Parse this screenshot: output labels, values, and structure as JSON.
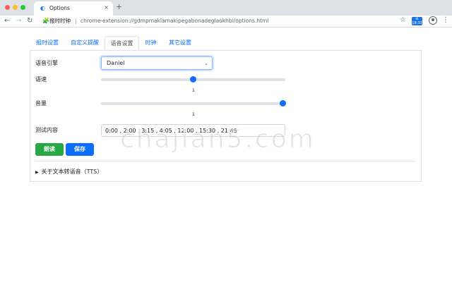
{
  "browser": {
    "tab_title": "Options",
    "tab_icon": "◐",
    "close_glyph": "×",
    "newtab_glyph": "+",
    "back_glyph": "←",
    "forward_glyph": "→",
    "reload_glyph": "↻",
    "site_icon": "🧩",
    "site_name": "报时时钟",
    "separator": "|",
    "url": "chrome-extension://gdmpmaklamakipegabonadeglaokhbl/options.html",
    "star_glyph": "☆",
    "extension_badge_top": "ılı",
    "extension_badge_time": "18:33",
    "menu_glyph": "⋮"
  },
  "tabs": [
    {
      "label": "报时设置",
      "active": false
    },
    {
      "label": "自定义提醒",
      "active": false
    },
    {
      "label": "语音设置",
      "active": true
    },
    {
      "label": "时钟",
      "active": false
    },
    {
      "label": "其它设置",
      "active": false
    }
  ],
  "form": {
    "engine_label": "语音引擎",
    "engine_value": "Daniel",
    "caret_glyph": "⌄",
    "rate_label": "语速",
    "rate_value": "1",
    "rate_fraction": 0.5,
    "volume_label": "音量",
    "volume_value": "1",
    "volume_fraction": 1.0,
    "test_label": "测试内容",
    "test_value": "0:00 , 2:00 , 3:15 , 4:05 , 12:00 , 15:30 , 21:45",
    "read_button": "朗读",
    "save_button": "保存",
    "details_triangle": "▶",
    "details_label": "关于文本转语音（TTS）"
  },
  "watermark": "chajian5.com",
  "colors": {
    "primary": "#0d6efd",
    "success": "#28a745",
    "chrome_blue": "#1a73e8"
  }
}
